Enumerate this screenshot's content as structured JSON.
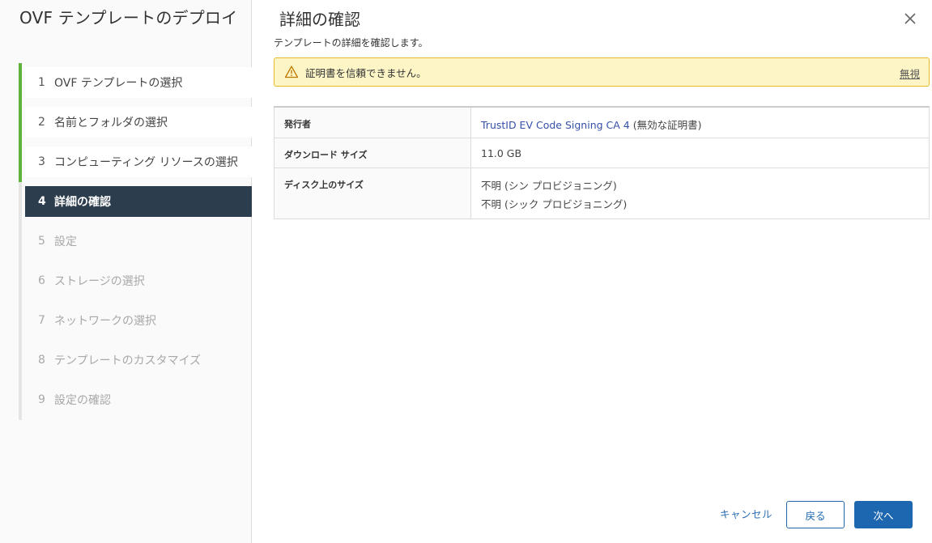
{
  "wizard": {
    "title": "OVF テンプレートのデプロイ"
  },
  "steps": [
    {
      "num": "1",
      "label": "OVF テンプレートの選択",
      "state": "done"
    },
    {
      "num": "2",
      "label": "名前とフォルダの選択",
      "state": "done"
    },
    {
      "num": "3",
      "label": "コンピューティング リソースの選択",
      "state": "done"
    },
    {
      "num": "4",
      "label": "詳細の確認",
      "state": "active"
    },
    {
      "num": "5",
      "label": "設定",
      "state": "todo"
    },
    {
      "num": "6",
      "label": "ストレージの選択",
      "state": "todo"
    },
    {
      "num": "7",
      "label": "ネットワークの選択",
      "state": "todo"
    },
    {
      "num": "8",
      "label": "テンプレートのカスタマイズ",
      "state": "todo"
    },
    {
      "num": "9",
      "label": "設定の確認",
      "state": "todo"
    }
  ],
  "main": {
    "title": "詳細の確認",
    "subtitle": "テンプレートの詳細を確認します。",
    "alert": {
      "message": "証明書を信頼できません。",
      "action": "無視"
    },
    "details": {
      "publisher": {
        "key": "発行者",
        "link": "TrustID EV Code Signing CA 4",
        "suffix": " (無効な証明書)"
      },
      "download_size": {
        "key": "ダウンロード サイズ",
        "value": "11.0 GB"
      },
      "disk_size": {
        "key": "ディスク上のサイズ",
        "thin": "不明 (シン プロビジョニング)",
        "thick": "不明 (シック プロビジョニング)"
      }
    }
  },
  "footer": {
    "cancel": "キャンセル",
    "back": "戻る",
    "next": "次へ"
  },
  "colors": {
    "accent": "#1d67b0",
    "done": "#5fb33d",
    "active_bg": "#2c3e4d",
    "alert_bg": "#fdf5c6",
    "alert_border": "#e7ba2d"
  }
}
